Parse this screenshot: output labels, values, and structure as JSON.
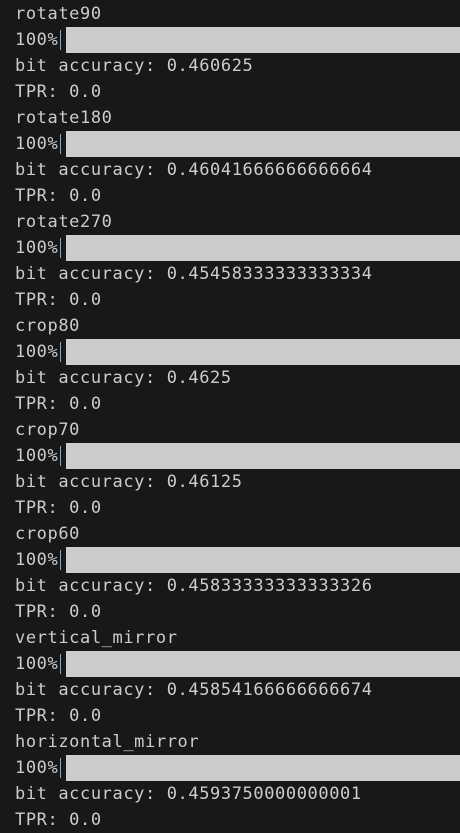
{
  "blocks": [
    {
      "name": "rotate90",
      "progress": "100%",
      "progress_fraction": 1.0,
      "accuracy": "bit accuracy: 0.460625",
      "tpr": "TPR: 0.0"
    },
    {
      "name": "rotate180",
      "progress": "100%",
      "progress_fraction": 1.0,
      "accuracy": "bit accuracy: 0.46041666666666664",
      "tpr": "TPR: 0.0"
    },
    {
      "name": "rotate270",
      "progress": "100%",
      "progress_fraction": 1.0,
      "accuracy": "bit accuracy: 0.45458333333333334",
      "tpr": "TPR: 0.0"
    },
    {
      "name": "crop80",
      "progress": "100%",
      "progress_fraction": 1.0,
      "accuracy": "bit accuracy: 0.4625",
      "tpr": "TPR: 0.0"
    },
    {
      "name": "crop70",
      "progress": "100%",
      "progress_fraction": 1.0,
      "accuracy": "bit accuracy: 0.46125",
      "tpr": "TPR: 0.0"
    },
    {
      "name": "crop60",
      "progress": "100%",
      "progress_fraction": 1.0,
      "accuracy": "bit accuracy: 0.45833333333333326",
      "tpr": "TPR: 0.0"
    },
    {
      "name": "vertical_mirror",
      "progress": "100%",
      "progress_fraction": 1.0,
      "accuracy": "bit accuracy: 0.45854166666666674",
      "tpr": "TPR: 0.0"
    },
    {
      "name": "horizontal_mirror",
      "progress": "100%",
      "progress_fraction": 1.0,
      "accuracy": "bit accuracy: 0.4593750000000001",
      "tpr": "TPR: 0.0"
    }
  ],
  "colors": {
    "background": "#181818",
    "text": "#cccccc",
    "bar": "#cccccc",
    "separator": "#7aa6d8"
  }
}
